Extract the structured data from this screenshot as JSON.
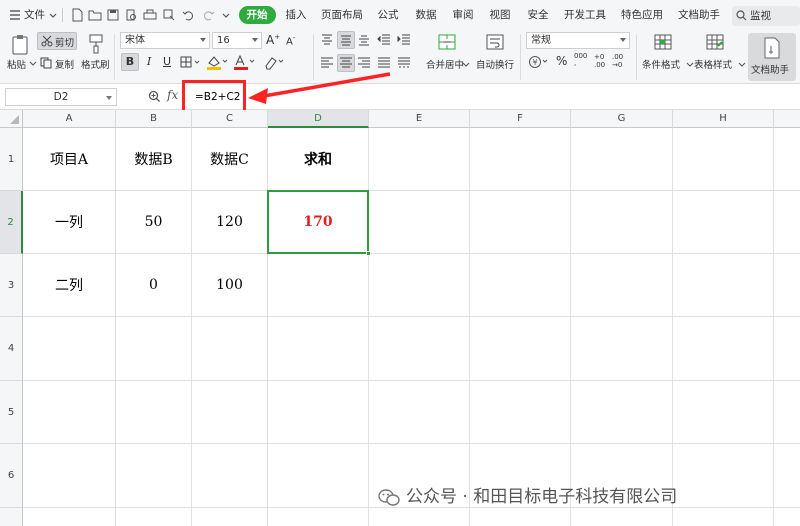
{
  "menubar": {
    "file_label": "文件",
    "tabs": [
      {
        "label": "开始",
        "active": true
      },
      {
        "label": "插入"
      },
      {
        "label": "页面布局"
      },
      {
        "label": "公式"
      },
      {
        "label": "数据"
      },
      {
        "label": "审阅"
      },
      {
        "label": "视图"
      },
      {
        "label": "安全"
      },
      {
        "label": "开发工具"
      },
      {
        "label": "特色应用"
      },
      {
        "label": "文档助手"
      }
    ],
    "search_label": "监视"
  },
  "ribbon": {
    "paste_label": "粘贴",
    "cut_label": "剪切",
    "copy_label": "复制",
    "format_painter_label": "格式刷",
    "font_name": "宋体",
    "font_size": "16",
    "bold_label": "B",
    "italic_label": "I",
    "underline_label": "U",
    "merge_center_label": "合并居中",
    "wrap_text_label": "自动换行",
    "number_format": "常规",
    "conditional_format_label": "条件格式",
    "table_style_label": "表格样式",
    "doc_helper_label": "文档助手"
  },
  "formula_bar": {
    "name_box": "D2",
    "fx_label": "fx",
    "formula": "=B2+C2"
  },
  "grid": {
    "columns": [
      "A",
      "B",
      "C",
      "D",
      "E",
      "F",
      "G",
      "H"
    ],
    "rows": [
      "1",
      "2",
      "3",
      "4",
      "5",
      "6"
    ],
    "cells": {
      "A1": "项目A",
      "B1": "数据B",
      "C1": "数据C",
      "D1": "求和",
      "A2": "一列",
      "B2": "50",
      "C2": "120",
      "D2": "170",
      "A3": "二列",
      "B3": "0",
      "C3": "100"
    },
    "selected_cell": "D2"
  },
  "watermark": "公众号 · 和田目标电子科技有限公司",
  "colors": {
    "accent": "#2eaa3f",
    "highlight": "#ff2222",
    "result": "#e02020"
  }
}
